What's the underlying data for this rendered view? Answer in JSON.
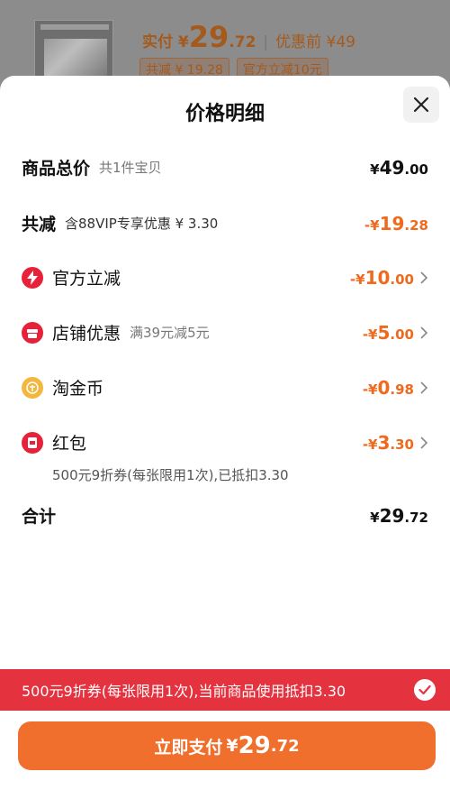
{
  "background": {
    "pay_label": "实付 ¥",
    "pay_int": "29",
    "pay_dec": ".72",
    "orig_label": "优惠前 ¥49",
    "tags": [
      "共减 ¥ 19.28",
      "官方立减10元"
    ]
  },
  "sheet": {
    "title": "价格明细",
    "total": {
      "label": "商品总价",
      "sub": "共1件宝贝",
      "currency": "¥",
      "int": "49",
      "dec": ".00"
    },
    "saved": {
      "label": "共减",
      "sub": "含88VIP专享优惠 ¥ 3.30",
      "currency": "-¥",
      "int": "19",
      "dec": ".28"
    },
    "items": [
      {
        "label": "官方立减",
        "sub": "",
        "icon": "lightning-icon",
        "currency": "-¥",
        "int": "10",
        "dec": ".00"
      },
      {
        "label": "店铺优惠",
        "sub": "满39元减5元",
        "icon": "shop-icon",
        "currency": "-¥",
        "int": "5",
        "dec": ".00"
      },
      {
        "label": "淘金币",
        "sub": "",
        "icon": "coin-icon",
        "currency": "-¥",
        "int": "0",
        "dec": ".98"
      },
      {
        "label": "红包",
        "sub": "",
        "icon": "red-packet-icon",
        "currency": "-¥",
        "int": "3",
        "dec": ".30"
      }
    ],
    "redpacket_note": "500元9折券(每张限用1次),已抵扣3.30",
    "sum": {
      "label": "合计",
      "currency": "¥",
      "int": "29",
      "dec": ".72"
    }
  },
  "banner": {
    "text": "500元9折券(每张限用1次),当前商品使用抵扣3.30"
  },
  "pay_button": {
    "label": "立即支付",
    "currency": "¥",
    "int": "29",
    "dec": ".72"
  },
  "colors": {
    "accent": "#f06a1e",
    "banner": "#e4323f",
    "button": "#f06f2d"
  }
}
